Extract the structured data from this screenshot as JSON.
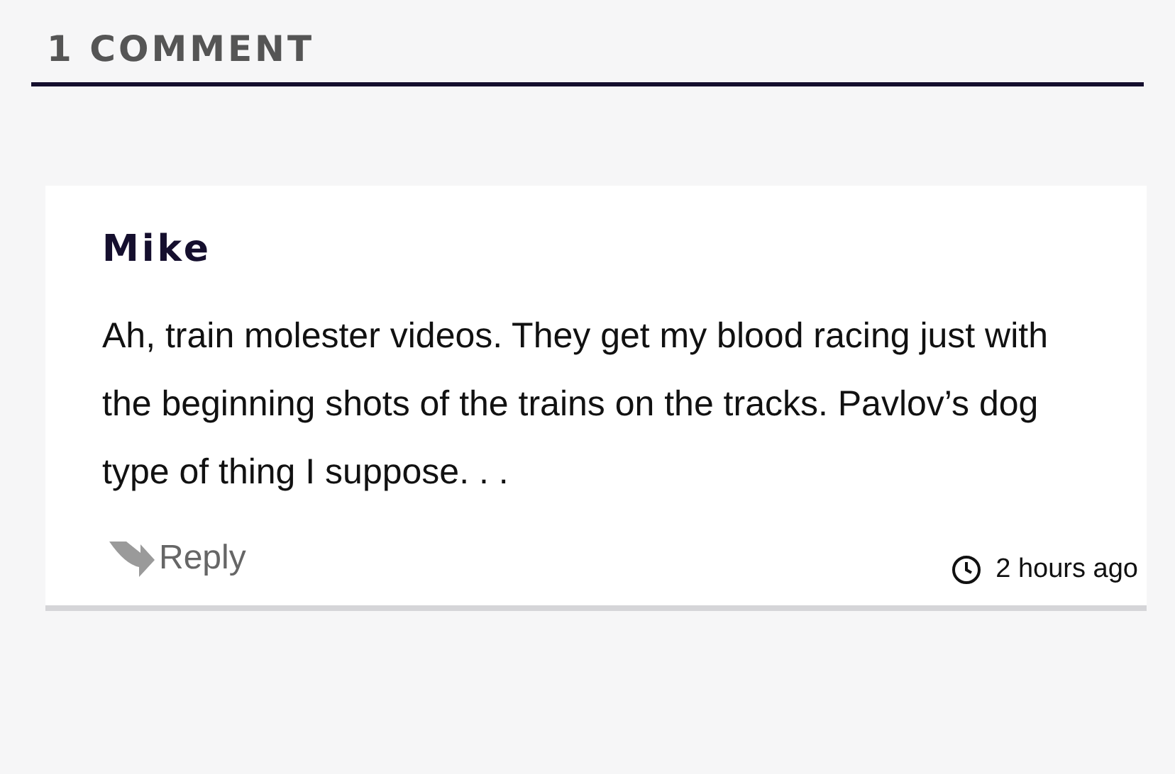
{
  "comments_heading": "1 COMMENT",
  "comments": [
    {
      "author": "Mike",
      "body": "Ah, train molester videos. They get my blood racing just with the beginning shots of the trains on the tracks. Pavlov’s dog type of thing I suppose. . .",
      "reply_label": "Reply",
      "time": "2 hours ago"
    }
  ]
}
